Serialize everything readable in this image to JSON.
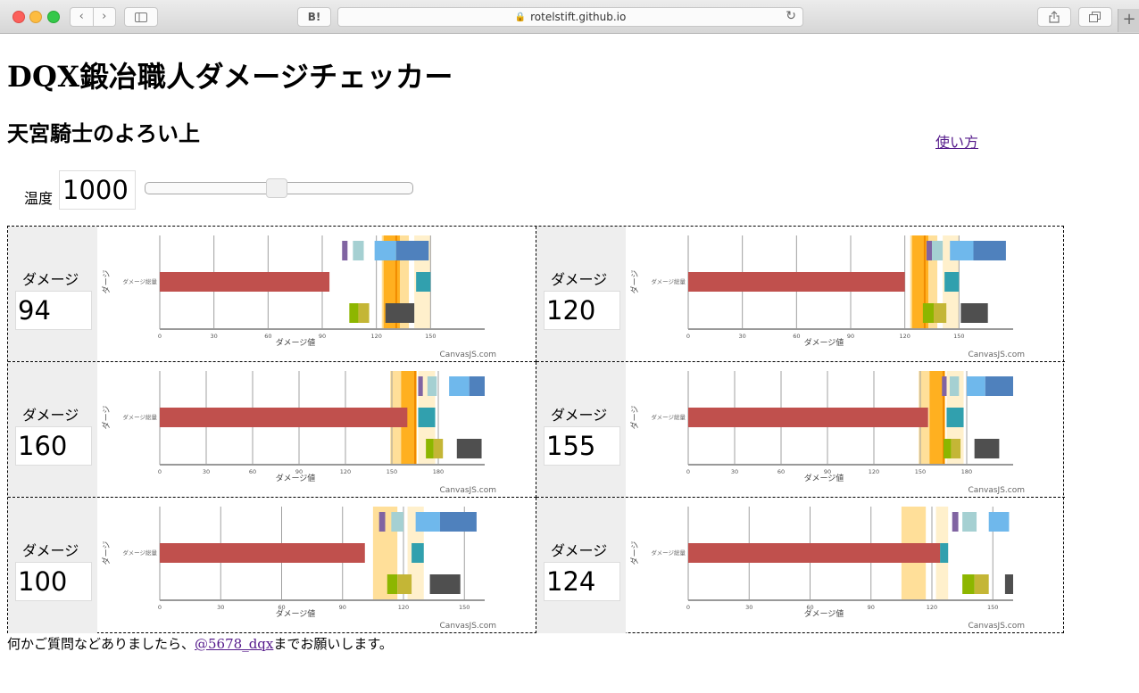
{
  "browser": {
    "url": "rotelstift.github.io",
    "hatena_label": "B!"
  },
  "page": {
    "title": "DQX鍛冶職人ダメージチェッカー",
    "subtitle": "天宮騎士のよろい上",
    "help_link": "使い方",
    "temperature": {
      "label": "温度",
      "value": "1000",
      "slider_fraction": 0.5
    },
    "damage_label": "ダメージ",
    "footer": {
      "prefix": "何かご質問などありましたら、",
      "link": "@5678_dqx",
      "suffix": "までお願いします。"
    }
  },
  "colors": {
    "bar": "#c0504d",
    "zone_main": "#ffdf99",
    "zone_light": "#fff0cc",
    "zone_core": "#ffb020",
    "target_line": "#f08a00",
    "purple": "#8064a2",
    "lightteal": "#a5d0d2",
    "skyblue": "#6fb8ec",
    "blue": "#4f81bd",
    "teal": "#31a0ae",
    "green": "#8db600",
    "olive": "#c4b636",
    "dark": "#4f4f4f"
  },
  "cells": [
    {
      "damage": "94",
      "chart": {
        "type": "bar",
        "category": "ダメージ総量",
        "ylabel": "ダージ",
        "xlabel": "ダメージ値",
        "credit": "CanvasJS.com",
        "ticks": [
          "0",
          "30",
          "60",
          "90",
          "120",
          "150"
        ],
        "xmax": 180,
        "value": 94,
        "zones": [
          [
            123,
            138,
            "main"
          ],
          [
            141,
            150,
            "light"
          ]
        ],
        "core": [
          124,
          133
        ],
        "target": 131,
        "blocks": [
          [
            101,
            104,
            0,
            "purple"
          ],
          [
            107,
            113,
            0,
            "lightteal"
          ],
          [
            119,
            131,
            0,
            "skyblue"
          ],
          [
            131,
            149,
            0,
            "blue"
          ],
          [
            142,
            150,
            1,
            "teal"
          ],
          [
            105,
            110,
            2,
            "green"
          ],
          [
            110,
            116,
            2,
            "olive"
          ],
          [
            125,
            141,
            2,
            "dark"
          ]
        ]
      }
    },
    {
      "damage": "120",
      "chart": {
        "type": "bar",
        "category": "ダメージ総量",
        "ylabel": "ダージ",
        "xlabel": "ダメージ値",
        "credit": "CanvasJS.com",
        "ticks": [
          "0",
          "30",
          "60",
          "90",
          "120",
          "150"
        ],
        "xmax": 180,
        "value": 120,
        "zones": [
          [
            123,
            138,
            "main"
          ],
          [
            141,
            150,
            "light"
          ]
        ],
        "core": [
          124,
          133
        ],
        "target": 131,
        "blocks": [
          [
            132,
            135,
            0,
            "purple"
          ],
          [
            135,
            141,
            0,
            "lightteal"
          ],
          [
            145,
            158,
            0,
            "skyblue"
          ],
          [
            158,
            176,
            0,
            "blue"
          ],
          [
            142,
            150,
            1,
            "teal"
          ],
          [
            130,
            136,
            2,
            "green"
          ],
          [
            136,
            143,
            2,
            "olive"
          ],
          [
            151,
            166,
            2,
            "dark"
          ]
        ]
      }
    },
    {
      "damage": "160",
      "chart": {
        "type": "bar",
        "category": "ダメージ総量",
        "ylabel": "ダージ",
        "xlabel": "ダメージ値",
        "credit": "CanvasJS.com",
        "ticks": [
          "0",
          "30",
          "60",
          "90",
          "120",
          "150",
          "180"
        ],
        "xmax": 210,
        "value": 160,
        "zones": [
          [
            149,
            162,
            "main"
          ],
          [
            167,
            178,
            "light"
          ]
        ],
        "core": [
          156,
          166
        ],
        "target": 165,
        "blocks": [
          [
            167,
            170,
            0,
            "purple"
          ],
          [
            173,
            179,
            0,
            "lightteal"
          ],
          [
            187,
            200,
            0,
            "skyblue"
          ],
          [
            200,
            212,
            0,
            "blue"
          ],
          [
            167,
            178,
            1,
            "teal"
          ],
          [
            172,
            177,
            2,
            "green"
          ],
          [
            177,
            183,
            2,
            "olive"
          ],
          [
            192,
            208,
            2,
            "dark"
          ]
        ]
      }
    },
    {
      "damage": "155",
      "chart": {
        "type": "bar",
        "category": "ダメージ総量",
        "ylabel": "ダージ",
        "xlabel": "ダメージ値",
        "credit": "CanvasJS.com",
        "ticks": [
          "0",
          "30",
          "60",
          "90",
          "120",
          "150",
          "180"
        ],
        "xmax": 210,
        "value": 155,
        "zones": [
          [
            149,
            162,
            "main"
          ],
          [
            167,
            178,
            "light"
          ]
        ],
        "core": [
          156,
          166
        ],
        "target": 165,
        "blocks": [
          [
            164,
            167,
            0,
            "purple"
          ],
          [
            169,
            175,
            0,
            "lightteal"
          ],
          [
            180,
            192,
            0,
            "skyblue"
          ],
          [
            192,
            210,
            0,
            "blue"
          ],
          [
            167,
            178,
            1,
            "teal"
          ],
          [
            165,
            170,
            2,
            "green"
          ],
          [
            170,
            176,
            2,
            "olive"
          ],
          [
            185,
            201,
            2,
            "dark"
          ]
        ]
      }
    },
    {
      "damage": "100",
      "chart": {
        "type": "bar",
        "category": "ダメージ総量",
        "ylabel": "ダージ",
        "xlabel": "ダメージ値",
        "credit": "CanvasJS.com",
        "ticks": [
          "0",
          "30",
          "60",
          "90",
          "120",
          "150"
        ],
        "xmax": 160,
        "value": 101,
        "zones": [
          [
            105,
            117,
            "main"
          ],
          [
            122,
            130,
            "light"
          ]
        ],
        "core": null,
        "target": null,
        "blocks": [
          [
            108,
            111,
            0,
            "purple"
          ],
          [
            114,
            120,
            0,
            "lightteal"
          ],
          [
            126,
            138,
            0,
            "skyblue"
          ],
          [
            138,
            156,
            0,
            "blue"
          ],
          [
            124,
            130,
            1,
            "teal"
          ],
          [
            112,
            117,
            2,
            "green"
          ],
          [
            117,
            124,
            2,
            "olive"
          ],
          [
            133,
            148,
            2,
            "dark"
          ]
        ]
      }
    },
    {
      "damage": "124",
      "chart": {
        "type": "bar",
        "category": "ダメージ総量",
        "ylabel": "ダージ",
        "xlabel": "ダメージ値",
        "credit": "CanvasJS.com",
        "ticks": [
          "0",
          "30",
          "60",
          "90",
          "120",
          "150"
        ],
        "xmax": 160,
        "value": 124,
        "zones": [
          [
            105,
            117,
            "main"
          ],
          [
            122,
            128,
            "light"
          ]
        ],
        "core": null,
        "target": null,
        "blocks": [
          [
            130,
            133,
            0,
            "purple"
          ],
          [
            135,
            142,
            0,
            "lightteal"
          ],
          [
            148,
            158,
            0,
            "skyblue"
          ],
          [
            124,
            128,
            1,
            "teal"
          ],
          [
            135,
            141,
            2,
            "green"
          ],
          [
            141,
            148,
            2,
            "olive"
          ],
          [
            156,
            160,
            2,
            "dark"
          ]
        ]
      }
    }
  ]
}
